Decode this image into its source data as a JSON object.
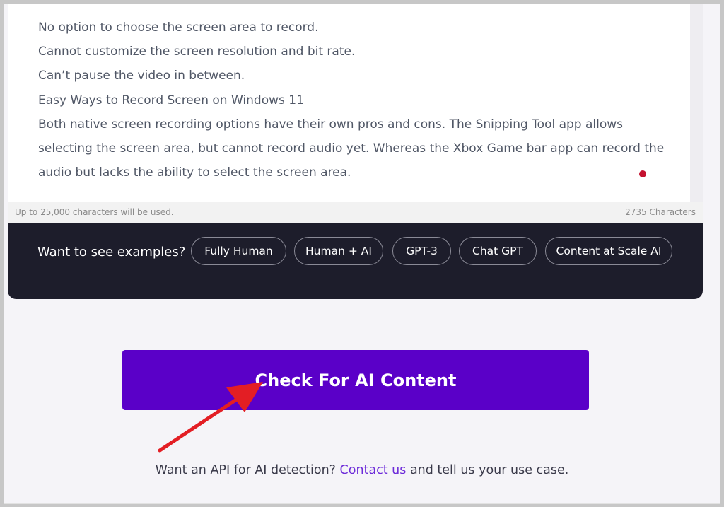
{
  "text_area": {
    "lines": [
      "No option to choose the screen area to record.",
      "Cannot customize the screen resolution and bit rate.",
      "Can’t pause the video in between.",
      "Easy Ways to Record Screen on Windows 11",
      "Both native screen recording options have their own pros and cons. The Snipping Tool app allows",
      "selecting the screen area, but cannot record audio yet. Whereas the Xbox Game bar app can record the",
      "audio but lacks the ability to select the screen area."
    ]
  },
  "info_bar": {
    "limit_text": "Up to 25,000 characters will be used.",
    "char_count": "2735 Characters"
  },
  "examples": {
    "label": "Want to see examples?",
    "pills": [
      "Fully Human",
      "Human + AI",
      "GPT-3",
      "Chat GPT",
      "Content at Scale AI"
    ]
  },
  "check_button": {
    "label": "Check For AI Content"
  },
  "api": {
    "prefix": "Want an API for AI detection? ",
    "link": "Contact us",
    "suffix": " and tell us your use case."
  },
  "colors": {
    "button_purple": "#5a00c8",
    "card_dark": "#1d1d2b",
    "arrow_red": "#e31e24",
    "link_purple": "#6d2bd9"
  }
}
